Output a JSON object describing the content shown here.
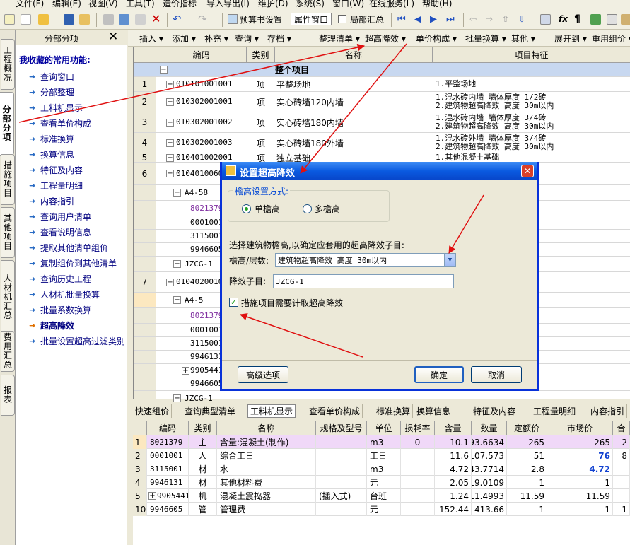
{
  "menu": [
    "文件(F)",
    "编辑(E)",
    "视图(V)",
    "工具(T)",
    "造价指标",
    "导入导出(I)",
    "维护(D)",
    "系统(S)",
    "窗口(W)",
    "在线服务(L)",
    "帮助(H)"
  ],
  "toolbar": {
    "budget_settings": "预算书设置",
    "property_window": "属性窗口",
    "local_summary": "局部汇总"
  },
  "left_tabs": [
    "工程概况",
    "分部分项",
    "措施项目",
    "其他项目",
    "人材机汇总",
    "费用汇总",
    "报表"
  ],
  "sidebar": {
    "title": "分部分项",
    "close": "✕",
    "favorites_label": "我收藏的常用功能:",
    "items": [
      "查询窗口",
      "分部整理",
      "工料机显示",
      "查看单价构成",
      "标准换算",
      "换算信息",
      "特征及内容",
      "工程量明细",
      "内容指引",
      "查询用户清单",
      "查看说明信息",
      "提取其他清单组价",
      "复制组价到其他清单",
      "查询历史工程",
      "人材机批量换算",
      "批量系数换算",
      "超高降效",
      "批量设置超高过滤类别"
    ],
    "selected_index": 16
  },
  "toolbar2": [
    "插入 ▾",
    "添加 ▾",
    "补充 ▾",
    "查询 ▾",
    "存档 ▾",
    "整理清单 ▾",
    "超高降效 ▾",
    "单价构成 ▾",
    "批量换算 ▾",
    "其他 ▾",
    "展开到 ▾",
    "重用组价 ▾"
  ],
  "grid": {
    "headers": [
      "编码",
      "类别",
      "名称",
      "项目特征"
    ],
    "group_label": "整个项目",
    "rows": [
      {
        "no": "1",
        "code": "010101001001",
        "type": "项",
        "name": "平整场地",
        "feat": [
          "1.平整场地"
        ]
      },
      {
        "no": "2",
        "code": "010302001001",
        "type": "项",
        "name": "实心砖墙120内墙",
        "feat": [
          "1.混水砖内墙 墙体厚度 1/2砖",
          "2.建筑物超高降效 高度 30m以内"
        ]
      },
      {
        "no": "3",
        "code": "010302001002",
        "type": "项",
        "name": "实心砖墙180内墙",
        "feat": [
          "1.混水砖内墙 墙体厚度 3/4砖",
          "2.建筑物超高降效 高度 30m以内"
        ]
      },
      {
        "no": "4",
        "code": "010302001003",
        "type": "项",
        "name": "实心砖墙180外墙",
        "feat": [
          "1.混水砖外墙 墙体厚度 3/4砖",
          "2.建筑物超高降效 高度 30m以内"
        ]
      },
      {
        "no": "5",
        "code": "010401002001",
        "type": "项",
        "name": "独立基础",
        "feat": [
          "1.其他混凝土基础"
        ]
      },
      {
        "no": "6",
        "code": "01040100600",
        "type": "",
        "name": "",
        "feat": [
          "以内"
        ]
      },
      {
        "no": "",
        "code": "A4-58",
        "type": "",
        "name": "",
        "feat": []
      },
      {
        "no": "",
        "code": "8021379",
        "type": "",
        "name": "",
        "feat": []
      },
      {
        "no": "",
        "code": "0001001",
        "type": "",
        "name": "",
        "feat": []
      },
      {
        "no": "",
        "code": "3115001",
        "type": "",
        "name": "",
        "feat": []
      },
      {
        "no": "",
        "code": "9946605",
        "type": "",
        "name": "",
        "feat": []
      },
      {
        "no": "",
        "code": "JZCG-1",
        "type": "",
        "name": "",
        "feat": []
      },
      {
        "no": "7",
        "code": "01040200100",
        "type": "",
        "name": "",
        "feat": [
          "形柱",
          "以内"
        ]
      },
      {
        "no": "",
        "code": "A4-5",
        "type": "",
        "name": "",
        "feat": []
      },
      {
        "no": "",
        "code": "8021379",
        "type": "",
        "name": "",
        "feat": []
      },
      {
        "no": "",
        "code": "0001001",
        "type": "",
        "name": "",
        "feat": []
      },
      {
        "no": "",
        "code": "3115001",
        "type": "",
        "name": "",
        "feat": []
      },
      {
        "no": "",
        "code": "9946131",
        "type": "",
        "name": "",
        "feat": []
      },
      {
        "no": "",
        "code": "9905441",
        "type": "",
        "name": "",
        "feat": []
      },
      {
        "no": "",
        "code": "9946605",
        "type": "",
        "name": "",
        "feat": []
      },
      {
        "no": "",
        "code": "JZCG-1",
        "type": "",
        "name": "",
        "feat": []
      }
    ]
  },
  "bottom_tabs": [
    "快速组价",
    "查询典型清单",
    "工料机显示",
    "查看单价构成",
    "标准换算",
    "换算信息",
    "特征及内容",
    "工程量明细",
    "内容指引"
  ],
  "bottom_active": 2,
  "bgrid": {
    "headers": [
      "",
      "编码",
      "类别",
      "名称",
      "规格及型号",
      "单位",
      "损耗率",
      "含量",
      "数量",
      "定额价",
      "市场价",
      "合"
    ],
    "rows": [
      [
        "1",
        "8021379",
        "主",
        "含量:混凝土(制作)",
        "",
        "m3",
        "0",
        "10.1",
        "93.6634",
        "265",
        "265",
        "2"
      ],
      [
        "2",
        "0001001",
        "人",
        "综合工日",
        "",
        "工日",
        "",
        "11.6",
        "107.573",
        "51",
        "76",
        "8"
      ],
      [
        "3",
        "3115001",
        "材",
        "水",
        "",
        "m3",
        "",
        "4.72",
        "43.7714",
        "2.8",
        "4.72",
        ""
      ],
      [
        "4",
        "9946131",
        "材",
        "其他材料费",
        "",
        "元",
        "",
        "2.05",
        "19.0109",
        "1",
        "1",
        ""
      ],
      [
        "5",
        "9905441",
        "机",
        "混凝土震捣器",
        "(插入式)",
        "台班",
        "",
        "1.24",
        "11.4993",
        "11.59",
        "11.59",
        ""
      ],
      [
        "10",
        "9946605",
        "管",
        "管理费",
        "",
        "元",
        "",
        "152.44",
        "1413.66",
        "1",
        "1",
        "1"
      ]
    ]
  },
  "dialog": {
    "title": "设置超高降效",
    "close": "✕",
    "group_label": "檐高设置方式:",
    "radio_single": "单檐高",
    "radio_multi": "多檐高",
    "instruction": "选择建筑物檐高,以确定应套用的超高降效子目:",
    "height_label": "檐高/层数:",
    "height_value": "建筑物超高降效 高度 30m以内",
    "sub_label": "降效子目:",
    "sub_value": "JZCG-1",
    "checkbox_label": "措施项目需要计取超高降效",
    "btn_advanced": "高级选项",
    "btn_ok": "确定",
    "btn_cancel": "取消"
  },
  "colors": {
    "title_blue": "#0a5ae0",
    "arrow_red": "#e01010",
    "highlight_pink": "#f0d8f8",
    "link_blue": "#000080"
  }
}
